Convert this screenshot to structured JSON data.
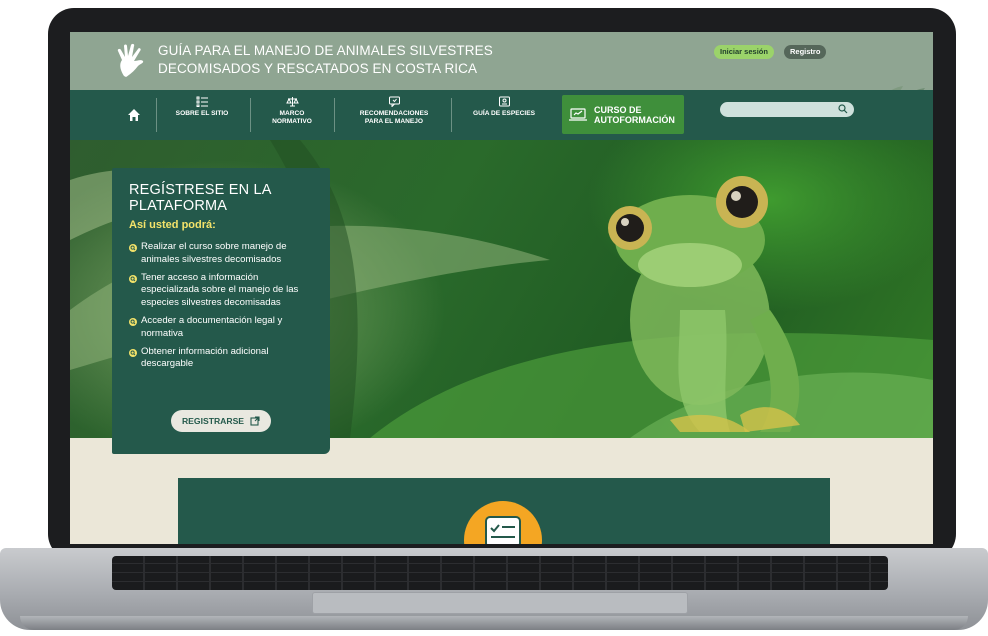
{
  "site": {
    "title_line1": "GUÍA PARA EL MANEJO DE ANIMALES SILVESTRES",
    "title_line2": "DECOMISADOS Y RESCATADOS EN COSTA RICA",
    "logo_icon": "hand-leaf-icon"
  },
  "auth": {
    "login_label": "Iniciar sesión",
    "register_label": "Registro"
  },
  "nav": {
    "home_icon": "home-icon",
    "items": [
      {
        "label_line1": "SOBRE EL SITIO",
        "label_line2": "",
        "icon": "list-icon"
      },
      {
        "label_line1": "MARCO",
        "label_line2": "NORMATIVO",
        "icon": "scales-icon"
      },
      {
        "label_line1": "RECOMENDACIONES",
        "label_line2": "PARA EL MANEJO",
        "icon": "chat-icon"
      },
      {
        "label_line1": "GUÍA DE ESPECIES",
        "label_line2": "",
        "icon": "id-card-icon"
      }
    ],
    "cta_line1": "CURSO DE",
    "cta_line2": "AUTOFORMACIÓN",
    "cta_icon": "laptop-icon",
    "search_placeholder": "",
    "search_icon": "search-icon"
  },
  "promo": {
    "title_line1": "REGÍSTRESE EN LA",
    "title_line2": "PLATAFORMA",
    "subtitle": "Así usted podrá:",
    "benefits": [
      "Realizar el curso sobre manejo de animales silvestres decomisados",
      "Tener acceso a información especializada sobre el manejo de las especies silvestres decomisadas",
      "Acceder a documentación legal y normativa",
      "Obtener información adicional descargable"
    ],
    "button_label": "REGISTRARSE",
    "button_icon": "external-link-icon"
  },
  "colors": {
    "primary": "#24594b",
    "header": "#8fa592",
    "accent_green": "#3f8f3b",
    "accent_yellow": "#f4e36a",
    "login_button": "#9bd36a",
    "orange": "#f4a623",
    "background": "#ebe7d8"
  }
}
